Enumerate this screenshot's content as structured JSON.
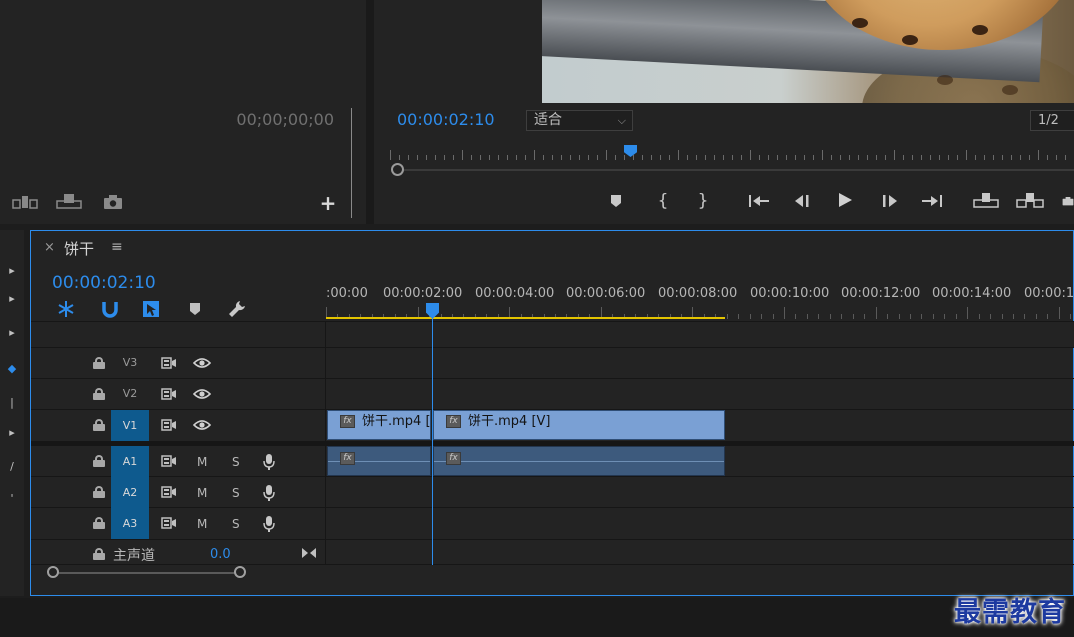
{
  "source_monitor": {
    "timecode": "00;00;00;00"
  },
  "program_monitor": {
    "timecode": "00:00:02:10",
    "fit": "适合",
    "resolution": "1/2",
    "playhead_fraction": 0.36
  },
  "timeline": {
    "close": "×",
    "sequence_name": "饼干",
    "menu": "≡",
    "timecode": "00:00:02:10",
    "ruler_labels": [
      ":00:00",
      "00:00:02:00",
      "00:00:04:00",
      "00:00:06:00",
      "00:00:08:00",
      "00:00:10:00",
      "00:00:12:00",
      "00:00:14:00",
      "00:00:1"
    ],
    "video_tracks": [
      {
        "name": "V3",
        "targeted": false
      },
      {
        "name": "V2",
        "targeted": false
      },
      {
        "name": "V1",
        "targeted": true
      }
    ],
    "audio_tracks": [
      {
        "name": "A1",
        "mute": "M",
        "solo": "S"
      },
      {
        "name": "A2",
        "mute": "M",
        "solo": "S"
      },
      {
        "name": "A3",
        "mute": "M",
        "solo": "S"
      }
    ],
    "master": {
      "label": "主声道",
      "value": "0.0"
    },
    "clips": {
      "video_1": "饼干.mp4 [",
      "video_2": "饼干.mp4 [V]",
      "fx": "fx"
    }
  },
  "watermark": "最需教育",
  "colors": {
    "accent": "#2d8ceb",
    "clip_video": "#7aa0d4",
    "clip_audio": "#3d5a7d",
    "work_area": "#e3c400",
    "track_target": "#0e5a8e"
  },
  "icons": {
    "program_controls": [
      "add-marker-icon",
      "mark-in-icon",
      "mark-out-icon",
      "go-to-in-icon",
      "step-back-icon",
      "play-icon",
      "step-forward-icon",
      "go-to-out-icon",
      "lift-icon",
      "extract-icon",
      "export-frame-icon"
    ],
    "source_controls": [
      "insert-icon",
      "overwrite-icon",
      "camera-icon",
      "add-button-icon"
    ],
    "timeline_tools": [
      "nest-icon",
      "snap-icon",
      "linked-selection-icon",
      "add-marker-icon",
      "settings-wrench-icon"
    ]
  }
}
